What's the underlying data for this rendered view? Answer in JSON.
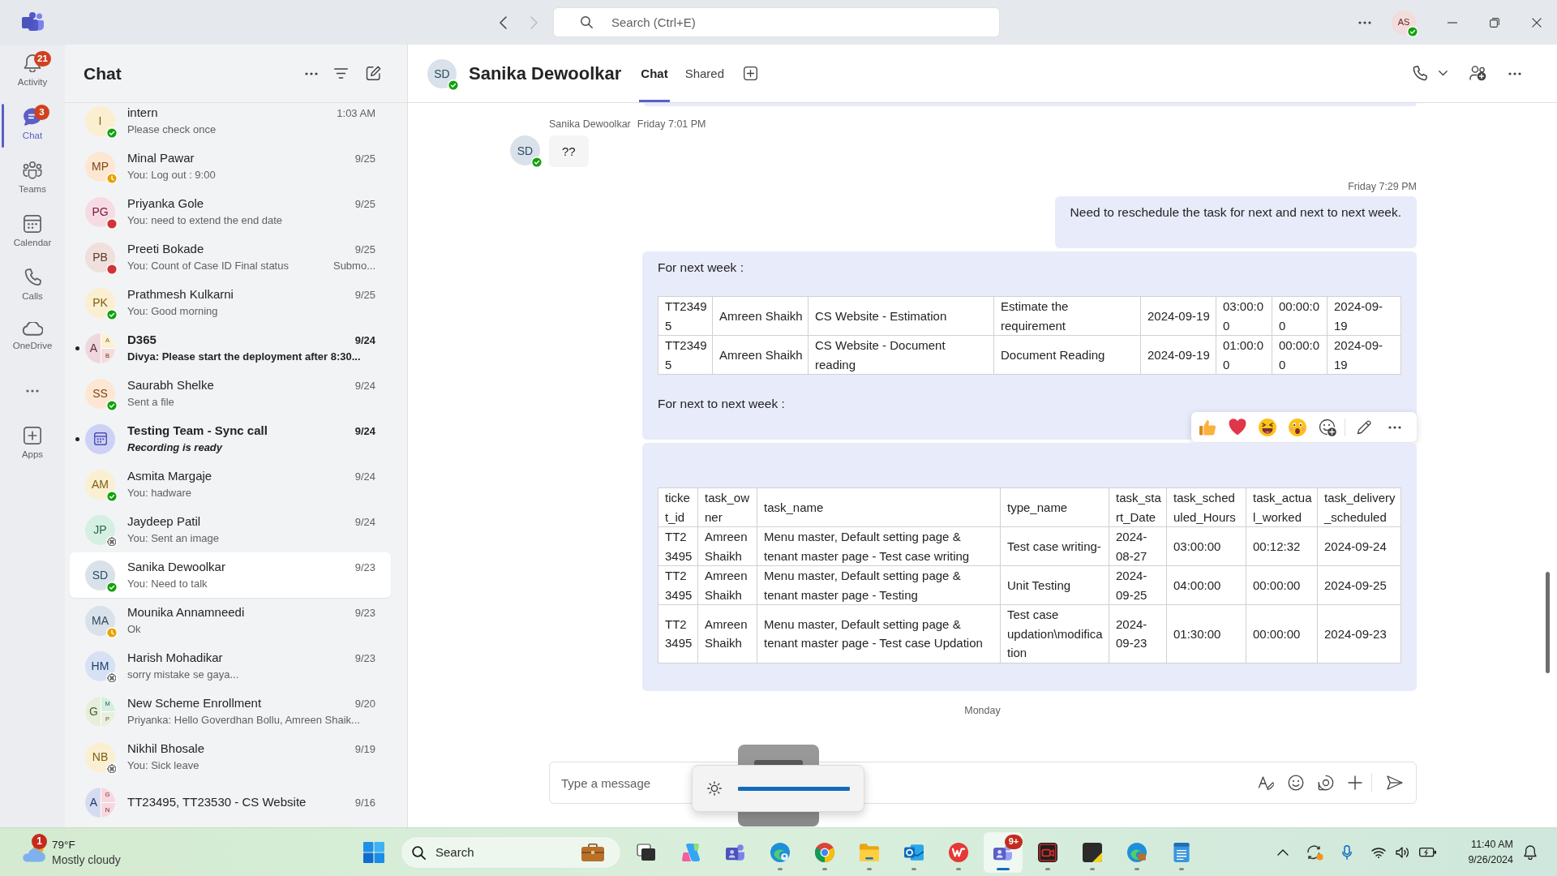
{
  "titlebar": {
    "back": {
      "disabled": false
    },
    "forward": {
      "disabled": true
    },
    "search": {
      "placeholder": "Search (Ctrl+E)"
    },
    "user": {
      "initials": "AS",
      "color": "#f3dcdc",
      "status": {
        "kind": "available",
        "color": "#13a10e"
      }
    }
  },
  "rail": {
    "items": [
      {
        "label": "Activity",
        "badge": "21",
        "selected": false
      },
      {
        "label": "Chat",
        "badge": "3",
        "selected": true
      },
      {
        "label": "Teams",
        "selected": false
      },
      {
        "label": "Calendar",
        "selected": false
      },
      {
        "label": "Calls",
        "selected": false
      },
      {
        "label": "OneDrive",
        "selected": false
      }
    ],
    "apps": {
      "label": "Apps"
    }
  },
  "chat_list": {
    "title": "Chat",
    "chats": [
      {
        "kind": "person",
        "name": "intern",
        "preview": "Please check once",
        "time": "1:03 AM",
        "initials": "I",
        "color": "#fbefd2",
        "status": {
          "kind": "available",
          "color": "#13a10e"
        },
        "unread": false,
        "selected": false
      },
      {
        "kind": "person",
        "name": "Minal Pawar",
        "preview": "You: Log out : 9:00",
        "time": "9/25",
        "initials": "MP",
        "color": "#fde7d3",
        "status": {
          "kind": "away",
          "color": "#eaa300"
        },
        "unread": false,
        "selected": false
      },
      {
        "kind": "person",
        "name": "Priyanka Gole",
        "preview": "You: need to extend the end date",
        "time": "9/25",
        "initials": "PG",
        "color": "#f7dbe4",
        "status": {
          "kind": "busy",
          "color": "#d13438"
        },
        "unread": false,
        "selected": false
      },
      {
        "kind": "person",
        "name": "Preeti Bokade",
        "preview": "You: Count of Case ID Final status",
        "preview_end": "Submo...",
        "time": "9/25",
        "initials": "PB",
        "color": "#efe0dc",
        "status": {
          "kind": "busy",
          "color": "#d13438"
        },
        "unread": false,
        "selected": false
      },
      {
        "kind": "person",
        "name": "Prathmesh Kulkarni",
        "preview": "You: Good morning",
        "time": "9/25",
        "initials": "PK",
        "color": "#fbefd2",
        "status": {
          "kind": "available",
          "color": "#13a10e"
        },
        "unread": false,
        "selected": false
      },
      {
        "kind": "group",
        "name": "D365",
        "preview": "Divya: Please start the deployment after 8:30...",
        "time": "9/24",
        "members": [
          {
            "initial": "A",
            "color": "#eed7dd"
          },
          {
            "initial": "A",
            "color": "#fcf0d4"
          },
          {
            "initial": "B",
            "color": "#f5dcdc"
          }
        ],
        "unread": true,
        "selected": false
      },
      {
        "kind": "person",
        "name": "Saurabh Shelke",
        "preview": "Sent a file",
        "time": "9/24",
        "initials": "SS",
        "color": "#fde7d3",
        "status": {
          "kind": "available",
          "color": "#13a10e"
        },
        "unread": false,
        "selected": false
      },
      {
        "kind": "meeting",
        "name": "Testing Team - Sync call",
        "preview": "Recording is ready",
        "time": "9/24",
        "color": "#cdd1f6",
        "unread": true,
        "selected": false
      },
      {
        "kind": "person",
        "name": "Asmita Margaje",
        "preview": "You: hadware",
        "time": "9/24",
        "initials": "AM",
        "color": "#fbefd2",
        "status": {
          "kind": "available",
          "color": "#13a10e"
        },
        "unread": false,
        "selected": false
      },
      {
        "kind": "person",
        "name": "Jaydeep Patil",
        "preview": "You: Sent an image",
        "time": "9/24",
        "initials": "JP",
        "color": "#d6efe3",
        "status": {
          "kind": "offline",
          "color": "#707070"
        },
        "unread": false,
        "selected": false
      },
      {
        "kind": "person",
        "name": "Sanika Dewoolkar",
        "preview": "You: Need to talk",
        "time": "9/23",
        "initials": "SD",
        "color": "#d9e2ea",
        "status": {
          "kind": "available",
          "color": "#13a10e"
        },
        "unread": false,
        "selected": true
      },
      {
        "kind": "person",
        "name": "Mounika Annamneedi",
        "preview": "Ok",
        "time": "9/23",
        "initials": "MA",
        "color": "#d9e2ea",
        "status": {
          "kind": "away",
          "color": "#eaa300"
        },
        "unread": false,
        "selected": false
      },
      {
        "kind": "person",
        "name": "Harish Mohadikar",
        "preview": "sorry mistake se gaya...",
        "time": "9/23",
        "initials": "HM",
        "color": "#d6e1f3",
        "status": {
          "kind": "offline",
          "color": "#707070"
        },
        "unread": false,
        "selected": false
      },
      {
        "kind": "group",
        "name": "New Scheme Enrollment",
        "preview": "Priyanka: Hello Goverdhan Bollu, Amreen Shaik...",
        "time": "9/20",
        "members": [
          {
            "initial": "G",
            "color": "#e6eedc"
          },
          {
            "initial": "M",
            "color": "#d6eee2"
          },
          {
            "initial": "P",
            "color": "#e9efdc"
          }
        ],
        "unread": false,
        "selected": false
      },
      {
        "kind": "person",
        "name": "Nikhil Bhosale",
        "preview": "You: Sick leave",
        "time": "9/19",
        "initials": "NB",
        "color": "#fbefd2",
        "status": {
          "kind": "offline",
          "color": "#707070"
        },
        "unread": false,
        "selected": false
      },
      {
        "kind": "group",
        "name": "TT23495, TT23530 - CS Website",
        "time": "9/16",
        "members": [
          {
            "initial": "A",
            "color": "#d5dcf0"
          },
          {
            "initial": "G",
            "color": "#f6d8de"
          },
          {
            "initial": "N",
            "color": "#f6d8de"
          }
        ],
        "unread": false,
        "selected": false
      }
    ]
  },
  "conversation": {
    "title": "Sanika Dewoolkar",
    "avatar": {
      "initials": "SD",
      "color": "#d9e2ea",
      "status": {
        "kind": "available",
        "color": "#13a10e"
      }
    },
    "tabs": [
      {
        "label": "Chat",
        "selected": true
      },
      {
        "label": "Shared",
        "selected": false
      }
    ],
    "messages": [
      {
        "kind": "incoming",
        "sender": "Sanika Dewoolkar",
        "time": "Friday 7:01 PM",
        "initials": "SD",
        "color": "#d9e2ea",
        "status": {
          "kind": "available",
          "color": "#13a10e"
        },
        "text": "??"
      },
      {
        "kind": "outgoing",
        "time": "Friday 7:29 PM",
        "bubbles": [
          {
            "hovered": false,
            "blocks": [
              {
                "kind": "paragraph",
                "text": "Need to reschedule the task for next and next to next week."
              }
            ]
          },
          {
            "hovered": true,
            "blocks": [
              {
                "kind": "paragraph",
                "text": "For next week :"
              },
              {
                "kind": "table",
                "rows": [
                  [
                    "TT23495",
                    "Amreen Shaikh",
                    "CS Website - Estimation",
                    "Estimate the requirement",
                    "2024-09-19",
                    "03:00:00",
                    "00:00:00",
                    "2024-09-19"
                  ],
                  [
                    "TT23495",
                    "Amreen Shaikh",
                    "CS Website - Document reading",
                    "Document Reading",
                    "2024-09-19",
                    "01:00:00",
                    "00:00:00",
                    "2024-09-19"
                  ]
                ]
              },
              {
                "kind": "paragraph",
                "text": "For next to next week :"
              }
            ]
          },
          {
            "hovered": false,
            "blocks": [
              {
                "kind": "table",
                "header": [
                  "ticket_id",
                  "task_owner",
                  "task_name",
                  "type_name",
                  "task_start_Date",
                  "task_scheduled_Hours",
                  "task_actual_worked",
                  "task_delivery_scheduled"
                ],
                "rows": [
                  [
                    "TT23495",
                    "Amreen Shaikh",
                    "Menu master, Default setting page & tenant master page - Test case writing",
                    "Test case writing-",
                    "2024-08-27",
                    "03:00:00",
                    "00:12:32",
                    "2024-09-24"
                  ],
                  [
                    "TT23495",
                    "Amreen Shaikh",
                    "Menu master, Default setting page & tenant master page - Testing",
                    "Unit Testing",
                    "2024-09-25",
                    "04:00:00",
                    "00:00:00",
                    "2024-09-25"
                  ],
                  [
                    "TT23495",
                    "Amreen Shaikh",
                    "Menu master, Default setting page & tenant master page - Test case Updation",
                    "Test case updation\\modification",
                    "2024-09-23",
                    "01:30:00",
                    "00:00:00",
                    "2024-09-23"
                  ]
                ]
              }
            ]
          }
        ]
      },
      {
        "kind": "divider",
        "label": "Monday"
      }
    ],
    "composer": {
      "placeholder": "Type a message"
    }
  },
  "brightness_flyout": {
    "level": 1
  },
  "taskbar": {
    "weather": {
      "badge": "1",
      "temp": "79°F",
      "condition": "Mostly cloudy"
    },
    "search": {
      "placeholder": "Search"
    },
    "apps": [
      {
        "running": false,
        "selected": false
      },
      {
        "running": false,
        "selected": false
      },
      {
        "running": false,
        "selected": false
      },
      {
        "running": true,
        "selected": false
      },
      {
        "running": true,
        "selected": false
      },
      {
        "running": true,
        "selected": false
      },
      {
        "running": true,
        "selected": false
      },
      {
        "running": true,
        "selected": false
      },
      {
        "running": true,
        "selected": true,
        "badge": "9+"
      },
      {
        "running": true,
        "selected": false
      },
      {
        "running": true,
        "selected": false
      },
      {
        "running": true,
        "selected": false
      },
      {
        "running": true,
        "selected": false
      }
    ],
    "clock": {
      "time": "11:40 AM",
      "date": "9/26/2024"
    }
  }
}
